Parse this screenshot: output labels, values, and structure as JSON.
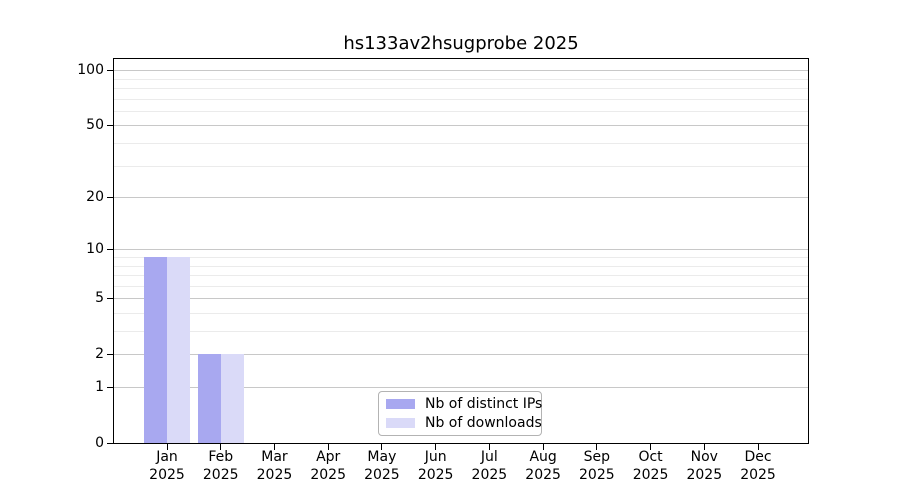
{
  "chart_data": {
    "type": "bar",
    "title": "hs133av2hsugprobe 2025",
    "categories": [
      {
        "month": "Jan",
        "year": "2025"
      },
      {
        "month": "Feb",
        "year": "2025"
      },
      {
        "month": "Mar",
        "year": "2025"
      },
      {
        "month": "Apr",
        "year": "2025"
      },
      {
        "month": "May",
        "year": "2025"
      },
      {
        "month": "Jun",
        "year": "2025"
      },
      {
        "month": "Jul",
        "year": "2025"
      },
      {
        "month": "Aug",
        "year": "2025"
      },
      {
        "month": "Sep",
        "year": "2025"
      },
      {
        "month": "Oct",
        "year": "2025"
      },
      {
        "month": "Nov",
        "year": "2025"
      },
      {
        "month": "Dec",
        "year": "2025"
      }
    ],
    "series": [
      {
        "name": "Nb of distinct IPs",
        "color": "#a8a8f0",
        "values": [
          9,
          2,
          0,
          0,
          0,
          0,
          0,
          0,
          0,
          0,
          0,
          0
        ]
      },
      {
        "name": "Nb of downloads",
        "color": "#dadaf8",
        "values": [
          9,
          2,
          0,
          0,
          0,
          0,
          0,
          0,
          0,
          0,
          0,
          0
        ]
      }
    ],
    "xlabel": "",
    "ylabel": "",
    "yscale": "log1p",
    "ylim": [
      0,
      115
    ],
    "yticks": [
      0,
      1,
      2,
      5,
      10,
      20,
      50,
      100
    ],
    "yticks_minor": [
      3,
      4,
      6,
      7,
      8,
      9,
      30,
      40,
      60,
      70,
      80,
      90
    ],
    "grid": true,
    "legend_position": "lower center"
  },
  "colors": {
    "grid_major": "#c8c8c8",
    "grid_minor": "#ebebeb",
    "axis": "#000000",
    "legend_border": "#b3b3b3",
    "background": "#ffffff"
  }
}
